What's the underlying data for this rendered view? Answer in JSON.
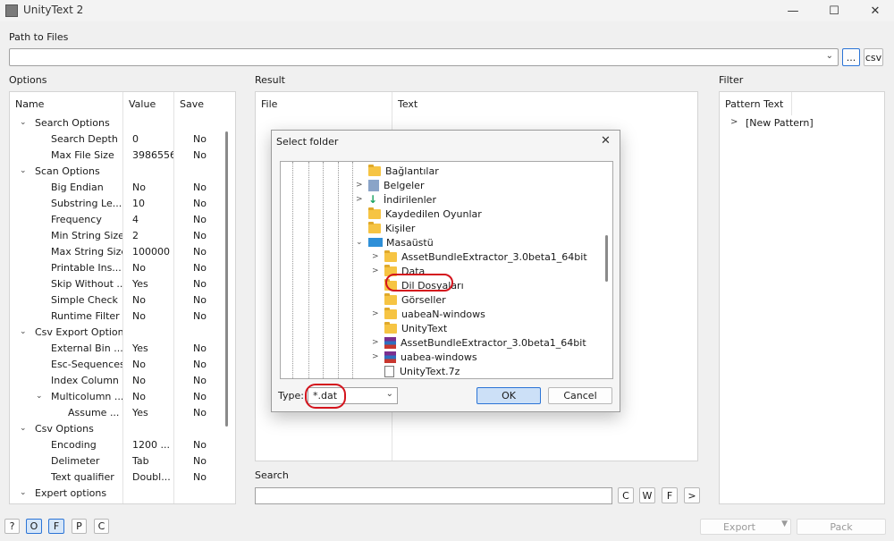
{
  "window": {
    "title": "UnityText 2",
    "minimize": "—",
    "maximize": "☐",
    "close": "✕"
  },
  "path": {
    "label": "Path to Files",
    "value": "",
    "browse": "...",
    "csv": "csv"
  },
  "options": {
    "label": "Options",
    "columns": [
      "Name",
      "Value",
      "Save"
    ],
    "rows": [
      {
        "name": "Search Options",
        "value": "",
        "save": "",
        "level": 0,
        "expander": "v"
      },
      {
        "name": "Search Depth",
        "value": "0",
        "save": "No",
        "level": 1
      },
      {
        "name": "Max File Size",
        "value": "3986556",
        "save": "No",
        "level": 1
      },
      {
        "name": "Scan Options",
        "value": "",
        "save": "",
        "level": 0,
        "expander": "v"
      },
      {
        "name": "Big Endian",
        "value": "No",
        "save": "No",
        "level": 1
      },
      {
        "name": "Substring Le...",
        "value": "10",
        "save": "No",
        "level": 1
      },
      {
        "name": "Frequency",
        "value": "4",
        "save": "No",
        "level": 1
      },
      {
        "name": "Min String Size",
        "value": "2",
        "save": "No",
        "level": 1
      },
      {
        "name": "Max String Size",
        "value": "100000",
        "save": "No",
        "level": 1
      },
      {
        "name": "Printable Ins...",
        "value": "No",
        "save": "No",
        "level": 1
      },
      {
        "name": "Skip Without ...",
        "value": "Yes",
        "save": "No",
        "level": 1
      },
      {
        "name": "Simple Check",
        "value": "No",
        "save": "No",
        "level": 1
      },
      {
        "name": "Runtime Filter",
        "value": "No",
        "save": "No",
        "level": 1
      },
      {
        "name": "Csv Export Options",
        "value": "",
        "save": "",
        "level": 0,
        "expander": "v"
      },
      {
        "name": "External Bin ...",
        "value": "Yes",
        "save": "No",
        "level": 1
      },
      {
        "name": "Esc-Sequences",
        "value": "No",
        "save": "No",
        "level": 1
      },
      {
        "name": "Index Column",
        "value": "No",
        "save": "No",
        "level": 1
      },
      {
        "name": "Multicolumn ...",
        "value": "No",
        "save": "No",
        "level": 1,
        "expander": "v"
      },
      {
        "name": "Assume ...",
        "value": "Yes",
        "save": "No",
        "level": 2
      },
      {
        "name": "Csv Options",
        "value": "",
        "save": "",
        "level": 0,
        "expander": "v"
      },
      {
        "name": "Encoding",
        "value": "1200 ...",
        "save": "No",
        "level": 1
      },
      {
        "name": "Delimeter",
        "value": "Tab",
        "save": "No",
        "level": 1
      },
      {
        "name": "Text qualifier",
        "value": "Doubl...",
        "save": "No",
        "level": 1
      },
      {
        "name": "Expert options",
        "value": "",
        "save": "",
        "level": 0,
        "expander": "v"
      }
    ]
  },
  "result": {
    "label": "Result",
    "columns": [
      "File",
      "Text"
    ]
  },
  "filter": {
    "label": "Filter",
    "column": "Pattern Text",
    "items": [
      "[New Pattern]"
    ]
  },
  "search": {
    "label": "Search",
    "value": "",
    "buttons": [
      "C",
      "W",
      "F",
      ">"
    ]
  },
  "footer": {
    "left_buttons": [
      "?",
      "O",
      "F",
      "P",
      "C"
    ],
    "export": "Export",
    "pack": "Pack"
  },
  "dialog": {
    "title": "Select folder",
    "close": "✕",
    "tree": [
      {
        "label": "Bağlantılar",
        "icon": "folder",
        "indent": 1,
        "expander": ""
      },
      {
        "label": "Belgeler",
        "icon": "doc",
        "indent": 1,
        "expander": ">"
      },
      {
        "label": "İndirilenler",
        "icon": "download",
        "indent": 1,
        "expander": ">"
      },
      {
        "label": "Kaydedilen Oyunlar",
        "icon": "folder",
        "indent": 1,
        "expander": ""
      },
      {
        "label": "Kişiler",
        "icon": "folder",
        "indent": 1,
        "expander": ""
      },
      {
        "label": "Masaüstü",
        "icon": "drive",
        "indent": 1,
        "expander": "v"
      },
      {
        "label": "AssetBundleExtractor_3.0beta1_64bit",
        "icon": "folder",
        "indent": 2,
        "expander": ">"
      },
      {
        "label": "Data",
        "icon": "folder",
        "indent": 2,
        "expander": ">"
      },
      {
        "label": "Dil Dosyaları",
        "icon": "folder",
        "indent": 2,
        "expander": "",
        "highlight": true
      },
      {
        "label": "Görseller",
        "icon": "folder",
        "indent": 2,
        "expander": ""
      },
      {
        "label": "uabeaN-windows",
        "icon": "folder",
        "indent": 2,
        "expander": ">"
      },
      {
        "label": "UnityText",
        "icon": "folder",
        "indent": 2,
        "expander": ""
      },
      {
        "label": "AssetBundleExtractor_3.0beta1_64bit",
        "icon": "archive",
        "indent": 2,
        "expander": ">"
      },
      {
        "label": "uabea-windows",
        "icon": "archive",
        "indent": 2,
        "expander": ">"
      },
      {
        "label": "UnityText.7z",
        "icon": "file",
        "indent": 2,
        "expander": ""
      }
    ],
    "type_label": "Type:",
    "type_value": "*.dat",
    "ok": "OK",
    "cancel": "Cancel"
  }
}
